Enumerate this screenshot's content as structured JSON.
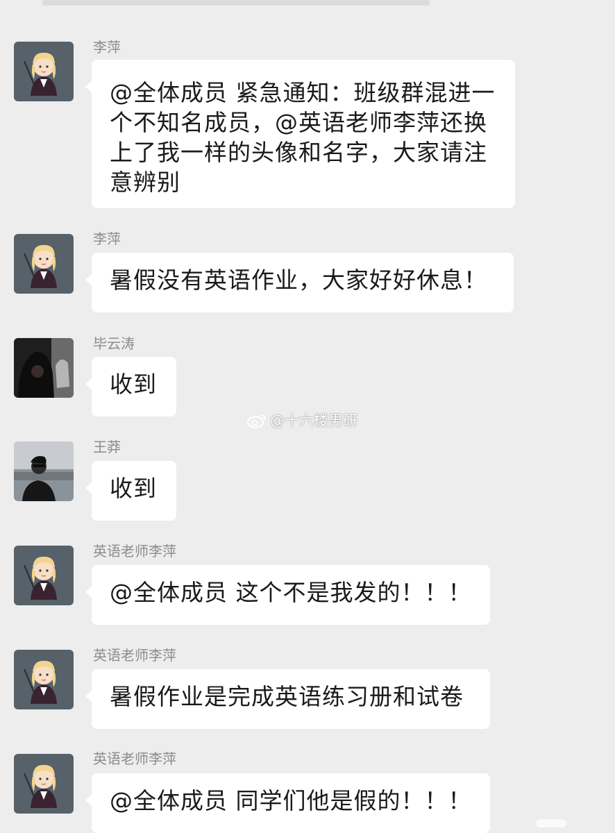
{
  "watermark": "@十六楼男研",
  "messages": [
    {
      "sender": "李萍",
      "text": "@全体成员 紧急通知：班级群混进一个不知名成员，@英语老师李萍还换上了我一样的头像和名字，大家请注意辨别",
      "avatar": "cartoon-girl-avatar"
    },
    {
      "sender": "李萍",
      "text": "暑假没有英语作业，大家好好休息！",
      "avatar": "cartoon-girl-avatar"
    },
    {
      "sender": "毕云涛",
      "text": "收到",
      "avatar": "dark-photo-avatar"
    },
    {
      "sender": "王莽",
      "text": "收到",
      "avatar": "man-photo-avatar"
    },
    {
      "sender": "英语老师李萍",
      "text": "@全体成员 这个不是我发的！！！",
      "avatar": "cartoon-girl-avatar"
    },
    {
      "sender": "英语老师李萍",
      "text": "暑假作业是完成英语练习册和试卷",
      "avatar": "cartoon-girl-avatar"
    },
    {
      "sender": "英语老师李萍",
      "text": "@全体成员 同学们他是假的！！！",
      "avatar": "cartoon-girl-avatar"
    }
  ],
  "colors": {
    "background": "#ededed",
    "bubble": "#ffffff",
    "sender_text": "#8c8c8c",
    "message_text": "#1a1a1a"
  }
}
